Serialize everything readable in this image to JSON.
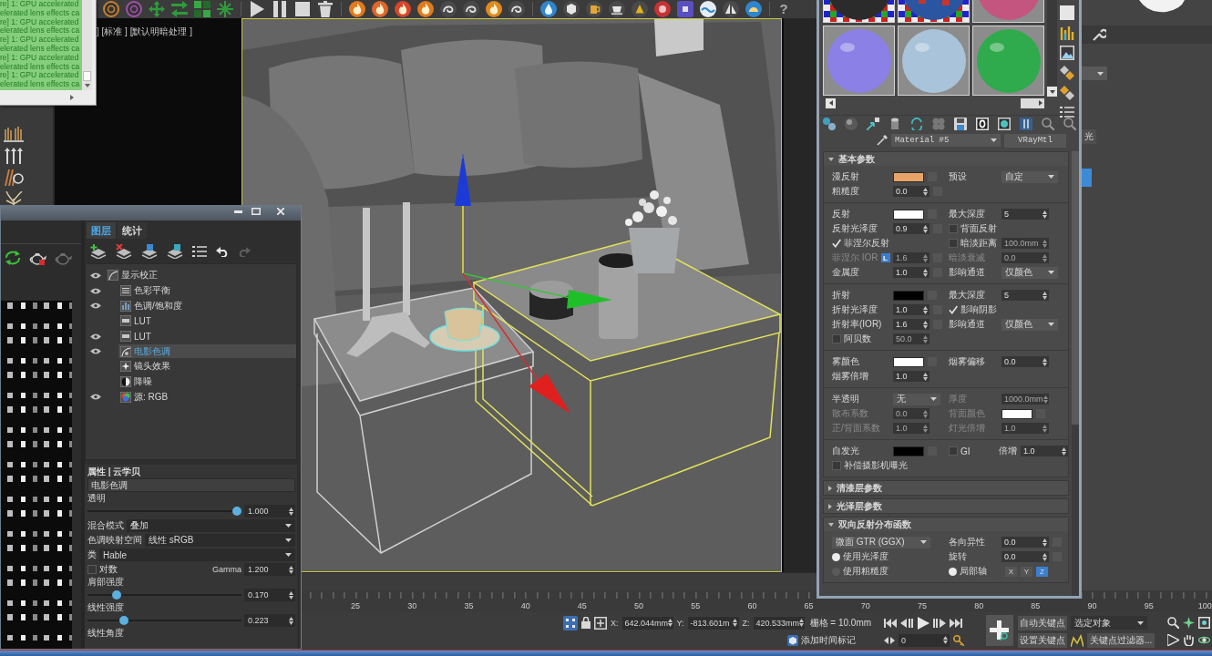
{
  "console": {
    "lines": [
      "re] 1: GPU accelerated",
      "elerated lens effects ca",
      "re] 1: GPU accelerated",
      "elerated lens effects ca",
      "re] 1: GPU accelerated",
      "elerated lens effects ca",
      "re] 1: GPU accelerated",
      "elerated lens effects ca",
      "re] 1: GPU accelerated",
      "elerated lens effects ca"
    ]
  },
  "toolbar": {
    "help": "?"
  },
  "viewport": {
    "label": "] [标准 ] [默认明暗处理 ]"
  },
  "command_panel": {
    "button": "光"
  },
  "layer_window": {
    "tabs": [
      {
        "label": "图层",
        "selected": true
      },
      {
        "label": "统计",
        "selected": false
      }
    ],
    "layers": [
      {
        "label": "显示校正",
        "kind": "correction",
        "visible": true,
        "selected": false,
        "children": [
          {
            "label": "色彩平衡",
            "kind": "balance",
            "visible": true,
            "selected": false
          },
          {
            "label": "色调/饱和度",
            "kind": "huesat",
            "visible": true,
            "selected": false
          },
          {
            "label": "LUT",
            "kind": "lut",
            "visible": false,
            "selected": false
          },
          {
            "label": "LUT",
            "kind": "lut",
            "visible": true,
            "selected": false
          },
          {
            "label": "电影色调",
            "kind": "filmic",
            "visible": true,
            "selected": true
          },
          {
            "label": "镜头效果",
            "kind": "lens",
            "visible": false,
            "selected": false
          },
          {
            "label": "降噪",
            "kind": "denoise",
            "visible": false,
            "selected": false
          },
          {
            "label": "源: RGB",
            "kind": "source",
            "visible": true,
            "selected": false
          }
        ]
      }
    ],
    "properties": {
      "title": "属性 | 云学贝",
      "name": "电影色调",
      "controls": [
        {
          "kind": "slider",
          "label": "透明",
          "level": 1.0,
          "value": "1.000"
        },
        {
          "kind": "dropdown",
          "label": "混合模式",
          "value": "叠加"
        },
        {
          "kind": "dropdown",
          "label": "色调映射空间",
          "value": "线性 sRGB"
        },
        {
          "kind": "dropdown",
          "label": "类",
          "value": "Hable"
        },
        {
          "kind": "check",
          "label": "对数",
          "checked": false,
          "param": "Gamma",
          "value": "1.200"
        },
        {
          "kind": "slider",
          "label": "肩部强度",
          "level": 0.17,
          "value": "0.170"
        },
        {
          "kind": "slider",
          "label": "线性强度",
          "level": 0.223,
          "value": "0.223"
        },
        {
          "kind": "label",
          "label": "线性角度"
        }
      ]
    }
  },
  "material_editor": {
    "slots": [
      {
        "kind": "glossy",
        "color": "#2b2b2b",
        "checker": true
      },
      {
        "kind": "textured",
        "color": "#2a55a0",
        "checker": true
      },
      {
        "kind": "glossy",
        "color": "#c4557f",
        "checker": false
      },
      {
        "kind": "glossy",
        "color": "#8a80e6",
        "checker": false
      },
      {
        "kind": "glossy",
        "color": "#a9c3da",
        "checker": false
      },
      {
        "kind": "glossy",
        "color": "#2faa4c",
        "checker": false
      }
    ],
    "material_name": "Material #5",
    "material_type": "VRayMtl",
    "rollouts": [
      {
        "title": "基本参数",
        "expanded": true,
        "groups": [
          [
            {
              "left": {
                "kind": "color",
                "label": "漫反射",
                "color": "#e8a468",
                "disabled": false
              },
              "right": {
                "kind": "dropdown",
                "label": "预设",
                "value": "自定"
              }
            },
            {
              "left": {
                "kind": "spinner",
                "label": "粗糙度",
                "value": "0.0",
                "disabled": false,
                "map": true
              }
            }
          ],
          [
            {
              "left": {
                "kind": "color",
                "label": "反射",
                "color": "#ffffff",
                "disabled": false
              },
              "right": {
                "kind": "spinner",
                "label": "最大深度",
                "value": "5",
                "disabled": false,
                "map": false
              }
            },
            {
              "left": {
                "kind": "spinner",
                "label": "反射光泽度",
                "value": "0.9",
                "disabled": false,
                "map": true
              },
              "right": {
                "kind": "check",
                "label": "背面反射",
                "checked": false
              }
            },
            {
              "left": {
                "kind": "check",
                "label": "菲涅尔反射",
                "checked": true
              },
              "right": {
                "kind": "check",
                "label": "暗淡距离",
                "checked": false,
                "disabled": true,
                "value": "100.0mm"
              }
            },
            {
              "left": {
                "kind": "spinner",
                "label": "菲涅尔 IOR",
                "lock": "L",
                "value": "1.6",
                "disabled": true,
                "map": true
              },
              "right": {
                "kind": "spinner",
                "label": "暗淡衰减",
                "value": "0.0",
                "disabled": true,
                "map": false
              }
            },
            {
              "left": {
                "kind": "spinner",
                "label": "金属度",
                "value": "1.0",
                "disabled": false,
                "map": true
              },
              "right": {
                "kind": "dropdown",
                "label": "影响通道",
                "value": "仅颜色"
              }
            }
          ],
          [
            {
              "left": {
                "kind": "color",
                "label": "折射",
                "color": "#000000",
                "disabled": false
              },
              "right": {
                "kind": "spinner",
                "label": "最大深度",
                "value": "5",
                "disabled": false,
                "map": false
              }
            },
            {
              "left": {
                "kind": "spinner",
                "label": "折射光泽度",
                "value": "1.0",
                "disabled": false,
                "map": true
              },
              "right": {
                "kind": "check",
                "label": "影响阴影",
                "checked": true
              }
            },
            {
              "left": {
                "kind": "spinner",
                "label": "折射率(IOR)",
                "value": "1.6",
                "disabled": false,
                "map": true
              },
              "right": {
                "kind": "dropdown",
                "label": "影响通道",
                "value": "仅颜色"
              }
            },
            {
              "left": {
                "kind": "check",
                "label": "阿贝数",
                "checked": false,
                "disabled": true,
                "value": "50.0"
              }
            }
          ],
          [
            {
              "left": {
                "kind": "color",
                "label": "雾颜色",
                "color": "#ffffff",
                "disabled": false
              },
              "right": {
                "kind": "spinner",
                "label": "烟雾偏移",
                "value": "0.0",
                "disabled": false,
                "map": false
              }
            },
            {
              "left": {
                "kind": "spinner",
                "label": "烟雾倍增",
                "value": "1.0",
                "disabled": false,
                "map": false
              }
            }
          ],
          [
            {
              "left": {
                "kind": "dropdown",
                "label": "半透明",
                "value": "无"
              },
              "right": {
                "kind": "spinner",
                "label": "厚度",
                "value": "1000.0mm",
                "disabled": true,
                "map": false
              }
            },
            {
              "left": {
                "kind": "spinner",
                "label": "散布系数",
                "value": "0.0",
                "disabled": true,
                "map": false
              },
              "right": {
                "kind": "color",
                "label": "背面颜色",
                "color": "#ffffff",
                "disabled": true
              }
            },
            {
              "left": {
                "kind": "spinner",
                "label": "正/背面系数",
                "value": "1.0",
                "disabled": true,
                "map": false
              },
              "right": {
                "kind": "spinner",
                "label": "灯光倍增",
                "value": "1.0",
                "disabled": true,
                "map": false
              }
            }
          ],
          [
            {
              "left": {
                "kind": "color",
                "label": "自发光",
                "color": "#000000",
                "disabled": false
              },
              "right": {
                "kind": "check",
                "label": "GI",
                "checked": false,
                "disabled": false,
                "param": "倍增",
                "value": "1.0"
              }
            },
            {
              "left": {
                "kind": "check",
                "label": "补偿摄影机曝光",
                "checked": false
              }
            }
          ]
        ]
      },
      {
        "title": "清漆层参数",
        "expanded": false
      },
      {
        "title": "光泽层参数",
        "expanded": false
      },
      {
        "title": "双向反射分布函数",
        "expanded": true,
        "groups": [
          [
            {
              "left": {
                "kind": "dropdown",
                "value": "微面 GTR (GGX)"
              },
              "right": {
                "kind": "spinner",
                "label": "各向异性",
                "value": "0.0",
                "disabled": false,
                "map": true
              }
            },
            {
              "left": {
                "kind": "radio",
                "label": "使用光泽度",
                "selected": true
              },
              "right": {
                "kind": "spinner",
                "label": "旋转",
                "value": "0.0",
                "disabled": false,
                "map": true
              }
            },
            {
              "left": {
                "kind": "radio",
                "label": "使用粗糙度",
                "selected": false
              },
              "right": {
                "kind": "radio",
                "label": "局部轴",
                "selected": true,
                "axes": [
                  {
                    "label": "X",
                    "selected": false
                  },
                  {
                    "label": "Y",
                    "selected": false
                  },
                  {
                    "label": "Z",
                    "selected": true
                  }
                ]
              }
            }
          ]
        ]
      }
    ]
  },
  "timeline": {
    "labels": [
      "25",
      "30",
      "35",
      "40",
      "45",
      "50",
      "55",
      "60",
      "65",
      "70",
      "75",
      "80",
      "85",
      "90",
      "95",
      "100"
    ]
  },
  "status_bar": {
    "coordinates": [
      {
        "label": "X:",
        "value": "642.044mm"
      },
      {
        "label": "Y:",
        "value": "-813.601m"
      },
      {
        "label": "Z:",
        "value": "420.533mm"
      }
    ],
    "grid": "栅格 = 10.0mm",
    "time_tag": "添加时间标记",
    "frame": "0",
    "auto_key": "自动关键点",
    "selection_set": "选定对象",
    "set_key": "设置关键点",
    "key_filters": "关键点过滤器..."
  }
}
